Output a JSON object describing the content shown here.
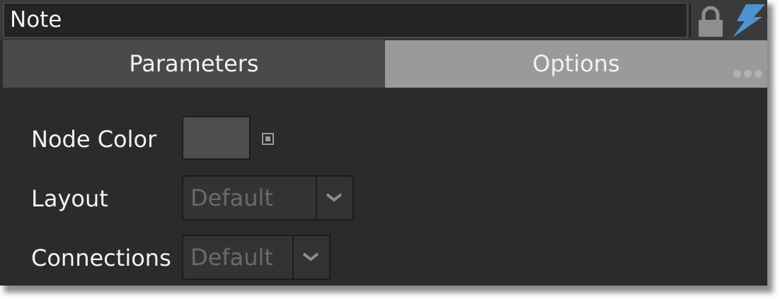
{
  "header": {
    "node_name": "Note",
    "lock_icon": "lock-icon",
    "bolt_icon": "lightning-bolt-icon",
    "bolt_color": "#4f93d1"
  },
  "tabs": [
    {
      "label": "Parameters",
      "active": true
    },
    {
      "label": "Options",
      "active": false
    }
  ],
  "more_icon": "more-dots-icon",
  "fields": {
    "node_color": {
      "label": "Node Color",
      "swatch_color": "#4d4d4d",
      "reset_icon": "reset-square-icon"
    },
    "layout": {
      "label": "Layout",
      "value": "Default"
    },
    "connections": {
      "label": "Connections",
      "value": "Default"
    }
  },
  "colors": {
    "panel_bg": "#2b2b2b",
    "active_tab": "#4a4a4a",
    "inactive_tab": "#9a9a9a",
    "text": "#f2f2f2",
    "disabled_text": "#6a6a6a"
  }
}
